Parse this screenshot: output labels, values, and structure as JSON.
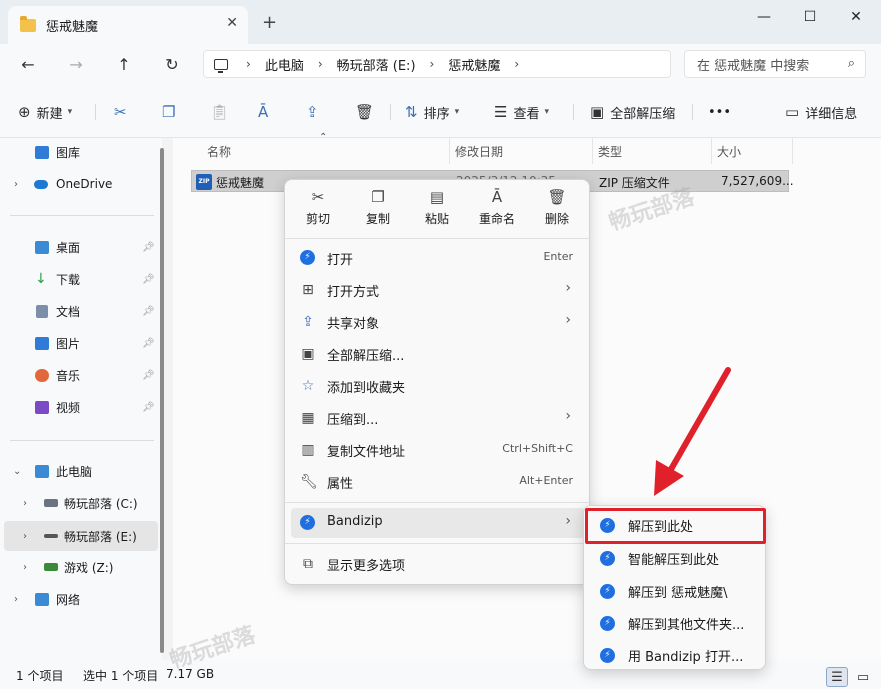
{
  "window": {
    "tab_title": "惩戒魅魔",
    "tab_close": "✕",
    "new_tab": "+",
    "minimize": "—",
    "maximize": "☐",
    "close": "✕"
  },
  "nav": {
    "back": "←",
    "forward": "→",
    "up": "↑",
    "refresh": "↻"
  },
  "breadcrumb": [
    "此电脑",
    "畅玩部落 (E:)",
    "惩戒魅魔"
  ],
  "search": {
    "placeholder": "在 惩戒魅魔 中搜索"
  },
  "toolbar": {
    "new_label": "新建",
    "sort_label": "排序",
    "view_label": "查看",
    "extract_all_label": "全部解压缩",
    "more_label": "•••",
    "details_label": "详细信息"
  },
  "sidebar": {
    "items": [
      {
        "label": "图库",
        "pinned": false
      },
      {
        "label": "OneDrive",
        "pinned": false
      },
      {
        "label": "桌面",
        "pinned": true
      },
      {
        "label": "下载",
        "pinned": true
      },
      {
        "label": "文档",
        "pinned": true
      },
      {
        "label": "图片",
        "pinned": true
      },
      {
        "label": "音乐",
        "pinned": true
      },
      {
        "label": "视频",
        "pinned": true
      },
      {
        "label": "此电脑",
        "pinned": false
      },
      {
        "label": "畅玩部落 (C:)",
        "pinned": false
      },
      {
        "label": "畅玩部落 (E:)",
        "pinned": false
      },
      {
        "label": "游戏 (Z:)",
        "pinned": false
      },
      {
        "label": "网络",
        "pinned": false
      }
    ]
  },
  "columns": [
    "名称",
    "修改日期",
    "类型",
    "大小"
  ],
  "file": {
    "name": "惩戒魅魔",
    "modified": "2025/3/12 10:35",
    "type": "ZIP 压缩文件",
    "size": "7,527,609..."
  },
  "context_menu": {
    "tools": [
      "剪切",
      "复制",
      "粘贴",
      "重命名",
      "删除"
    ],
    "items": [
      {
        "label": "打开",
        "shortcut": "Enter"
      },
      {
        "label": "打开方式",
        "shortcut": ""
      },
      {
        "label": "共享对象",
        "shortcut": ""
      },
      {
        "label": "全部解压缩...",
        "shortcut": ""
      },
      {
        "label": "添加到收藏夹",
        "shortcut": ""
      },
      {
        "label": "压缩到...",
        "shortcut": ""
      },
      {
        "label": "复制文件地址",
        "shortcut": "Ctrl+Shift+C"
      },
      {
        "label": "属性",
        "shortcut": "Alt+Enter"
      },
      {
        "label": "Bandizip",
        "shortcut": ""
      },
      {
        "label": "显示更多选项",
        "shortcut": ""
      }
    ]
  },
  "submenu": {
    "items": [
      "解压到此处",
      "智能解压到此处",
      "解压到 惩戒魅魔\\",
      "解压到其他文件夹...",
      "用 Bandizip 打开..."
    ]
  },
  "status": {
    "item_count": "1 个项目",
    "selected": "选中 1 个项目",
    "selected_size": "7.17 GB"
  },
  "watermark": "畅玩部落",
  "colors": {
    "accent": "#1f6fe0",
    "highlight": "#e0202a"
  }
}
